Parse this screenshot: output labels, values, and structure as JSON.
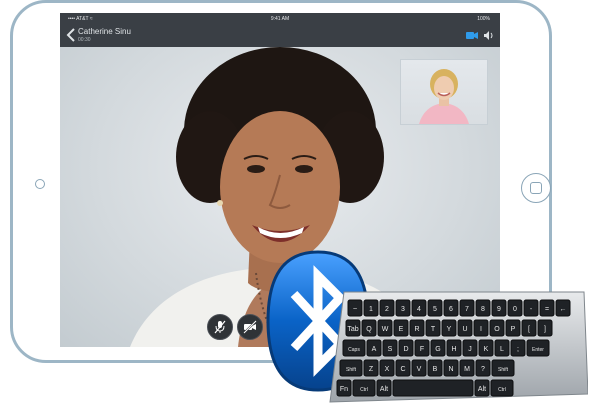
{
  "status_bar": {
    "carrier": "•••• AT&T ≈",
    "time": "9:41 AM",
    "battery": "100%"
  },
  "call": {
    "caller_name": "Catherine Sinu",
    "duration": "00:30"
  },
  "keyboard": {
    "row1": [
      "~",
      "1",
      "2",
      "3",
      "4",
      "5",
      "6",
      "7",
      "8",
      "9",
      "0",
      "-",
      "=",
      "←"
    ],
    "row2": [
      "Tab",
      "Q",
      "W",
      "E",
      "R",
      "T",
      "Y",
      "U",
      "I",
      "O",
      "P",
      "[",
      "]"
    ],
    "row3": [
      "Caps",
      "A",
      "S",
      "D",
      "F",
      "G",
      "H",
      "J",
      "K",
      "L",
      ";",
      "Enter"
    ],
    "row4": [
      "Shift",
      "Z",
      "X",
      "C",
      "V",
      "B",
      "N",
      "M",
      "?",
      "Shift"
    ],
    "row5": [
      "Fn",
      "Ctrl",
      "Alt",
      "",
      "Alt",
      "Ctrl"
    ]
  },
  "colors": {
    "frame": "#9db6c6",
    "bar": "#3a3f45",
    "bluetooth": "#0a63c7"
  },
  "icons": {
    "back": "chevron-left-icon",
    "camera_switch": "camera-switch-icon",
    "speaker": "speaker-icon",
    "mute": "microphone-mute-icon",
    "video_off": "video-off-icon",
    "bluetooth": "bluetooth-icon"
  }
}
